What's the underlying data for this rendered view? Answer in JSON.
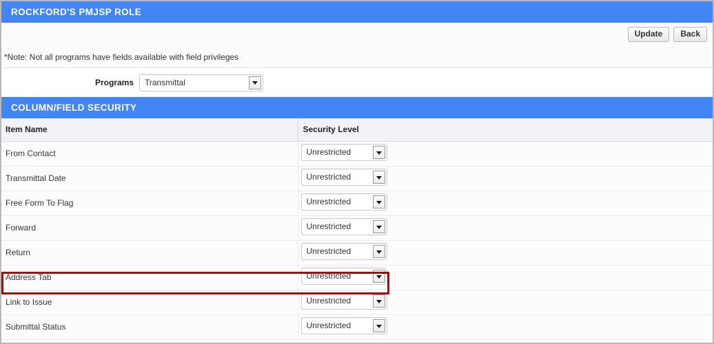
{
  "header": {
    "title": "ROCKFORD'S PMJSP ROLE"
  },
  "toolbar": {
    "update_label": "Update",
    "back_label": "Back"
  },
  "note": {
    "text": "*Note: Not all programs have fields available with field privileges"
  },
  "programs": {
    "label": "Programs",
    "selected": "Transmittal",
    "arrow_icon": "chevron-down-icon"
  },
  "security_section": {
    "title": "COLUMN/FIELD SECURITY",
    "columns": {
      "item_name": "Item Name",
      "security_level": "Security Level"
    },
    "rows": [
      {
        "item": "From Contact",
        "level": "Unrestricted"
      },
      {
        "item": "Transmittal Date",
        "level": "Unrestricted"
      },
      {
        "item": "Free Form To Flag",
        "level": "Unrestricted"
      },
      {
        "item": "Forward",
        "level": "Unrestricted"
      },
      {
        "item": "Return",
        "level": "Unrestricted"
      },
      {
        "item": "Address Tab",
        "level": "Unrestricted"
      },
      {
        "item": "Link to Issue",
        "level": "Unrestricted"
      },
      {
        "item": "Submittal Status",
        "level": "Unrestricted"
      }
    ]
  },
  "annotation": {
    "highlighted_row": "Address Tab",
    "color": "#9e1111"
  },
  "colors": {
    "section_bar": "#4285f4",
    "table_header": "#f1f3f7",
    "row_background": "#fcfcfc"
  }
}
